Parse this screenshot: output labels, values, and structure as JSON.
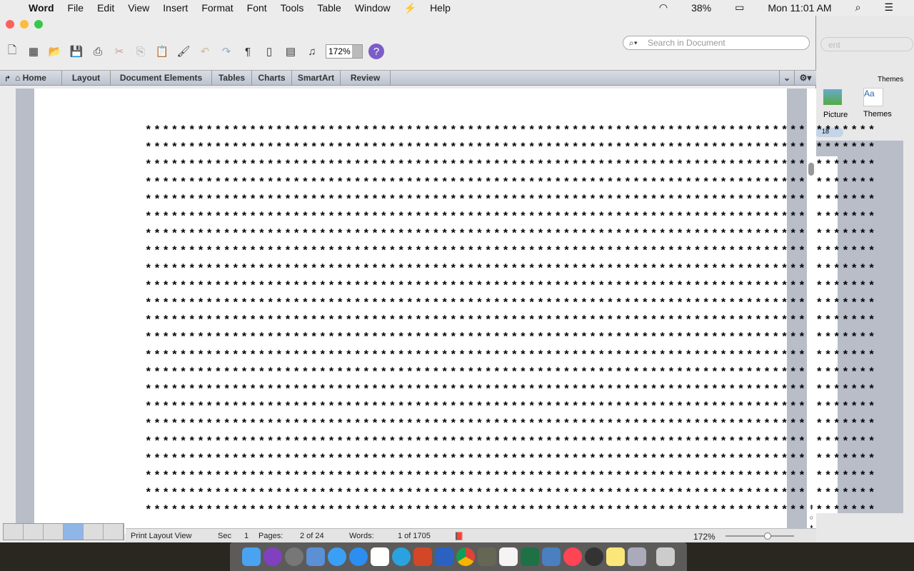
{
  "menubar": {
    "items": [
      "Word",
      "File",
      "Edit",
      "View",
      "Insert",
      "Format",
      "Font",
      "Tools",
      "Table",
      "Window",
      "Help"
    ],
    "battery": "38%",
    "clock": "Mon 11:01 AM"
  },
  "toolbar": {
    "zoom": "172%",
    "search_placeholder": "Search in Document"
  },
  "ribbon": {
    "tabs": [
      "Home",
      "Layout",
      "Document Elements",
      "Tables",
      "Charts",
      "SmartArt",
      "Review"
    ]
  },
  "document": {
    "line_text": "************************************************************************************",
    "line_count": 23
  },
  "status": {
    "view": "Print Layout View",
    "sec_label": "Sec",
    "sec": "1",
    "pages_label": "Pages:",
    "pages": "2 of 24",
    "words_label": "Words:",
    "words": "1 of 1705",
    "zoom": "172%"
  },
  "background_window": {
    "group_label": "Themes",
    "picture": "Picture",
    "themes": "Themes",
    "ruler": "18",
    "search_fragment": "ent"
  }
}
